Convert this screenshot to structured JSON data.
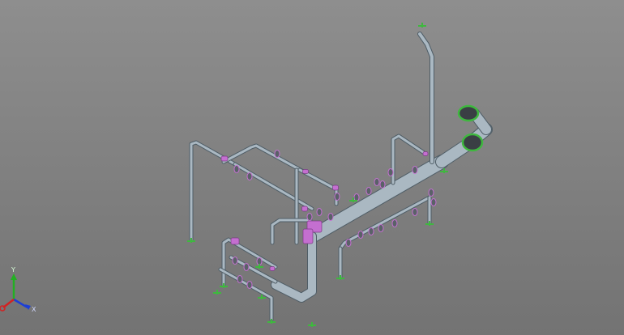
{
  "viewport": {
    "background_top": "#8e8e8e",
    "background_bottom": "#737373"
  },
  "colors": {
    "pipe_fill": "#aab8c2",
    "pipe_edge": "#4f5d66",
    "fitting_fill": "#c46fd0",
    "flange_fill": "#5a6168",
    "support_green": "#3fb83f",
    "axis_x": "#1d3fd6",
    "axis_y": "#22b022",
    "axis_z": "#d22222"
  },
  "view_triad": {
    "x_label": "X",
    "y_label": "Y",
    "z_label": ""
  }
}
